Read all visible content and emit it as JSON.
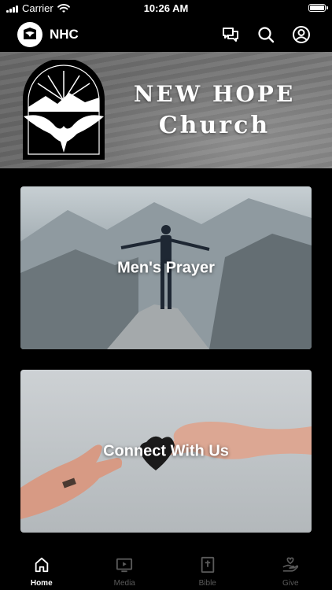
{
  "status_bar": {
    "carrier": "Carrier",
    "time": "10:26 AM"
  },
  "header": {
    "brand": "NHC"
  },
  "hero": {
    "title_line1": "NEW HOPE",
    "title_line2": "Church"
  },
  "cards": [
    {
      "label": "Men's Prayer"
    },
    {
      "label": "Connect With Us"
    }
  ],
  "nav": [
    {
      "label": "Home",
      "icon": "home-icon",
      "active": true
    },
    {
      "label": "Media",
      "icon": "media-icon",
      "active": false
    },
    {
      "label": "Bible",
      "icon": "bible-icon",
      "active": false
    },
    {
      "label": "Give",
      "icon": "give-icon",
      "active": false
    }
  ],
  "colors": {
    "background": "#000000",
    "active": "#ffffff",
    "inactive": "#5a5a5a"
  }
}
